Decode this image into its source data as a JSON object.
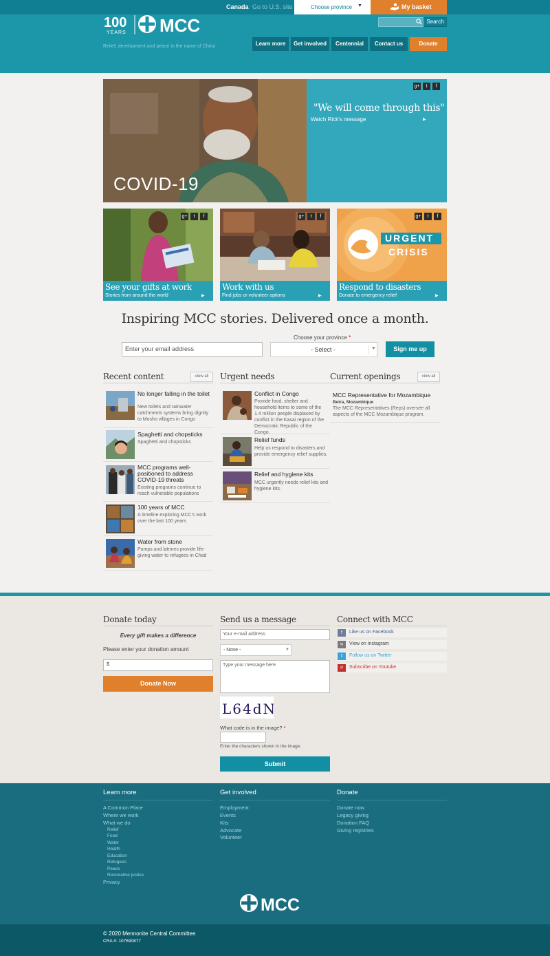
{
  "topbar": {
    "country": "Canada",
    "us_link": "Go to U.S. site",
    "province": "Choose province",
    "basket": "My basket"
  },
  "header": {
    "logo_years": "100",
    "logo_years_sub": "YEARS",
    "logo_name": "MCC",
    "tagline": "Relief, development and peace in the name of Christ",
    "search_button": "Search",
    "nav": [
      "Learn more",
      "Get involved",
      "Centennial",
      "Contact us",
      "Donate"
    ]
  },
  "hero": {
    "quote": "\"We will come through this\"",
    "link": "Watch Rick's message",
    "overlay": "COVID-19"
  },
  "social": [
    "g+",
    "t",
    "f"
  ],
  "tiles": [
    {
      "title": "See your gifts at work",
      "sub": "Stories from around the world"
    },
    {
      "title": "Work with us",
      "sub": "Find jobs or volunteer options"
    },
    {
      "title": "Respond to disasters",
      "sub": "Donate to emergency relief",
      "badge_top": "URGENT",
      "badge_bottom": "CRISIS"
    }
  ],
  "newsletter": {
    "title": "Inspiring MCC stories. Delivered once a month.",
    "email_placeholder": "Enter your email address",
    "province_label": "Choose your province",
    "required": "*",
    "select_value": "- Select -",
    "button": "Sign me up"
  },
  "recent": {
    "heading": "Recent content",
    "view_all": "view all",
    "items": [
      {
        "title": "No longer falling in the toilet",
        "desc": "New toilets and rainwater catchments systems bring dignity to Mosho villages in Congo"
      },
      {
        "title": "Spaghetti and chopsticks",
        "desc": "Spaghetti and chopsticks"
      },
      {
        "title": "MCC programs well-positioned to address COVID-19 threats",
        "desc": "Existing programs continue to reach vulnerable populations"
      },
      {
        "title": "100 years of MCC",
        "desc": "A timeline exploring MCC's work over the last 100 years"
      },
      {
        "title": "Water from stone",
        "desc": "Pumps and latrines provide life-giving water to refugees in Chad"
      }
    ]
  },
  "urgent": {
    "heading": "Urgent needs",
    "items": [
      {
        "title": "Conflict in Congo",
        "desc": "Provide food, shelter and household items to some of the 1.4 million people displaced by conflict in the Kasai region of the Democratic Republic of the Congo."
      },
      {
        "title": "Relief funds",
        "desc": "Help us respond to disasters and provide emergency relief supplies."
      },
      {
        "title": "Relief and hygiene kits",
        "desc": "MCC urgently needs relief kits and hygiene kits."
      }
    ]
  },
  "openings": {
    "heading": "Current openings",
    "view_all": "view all",
    "title": "MCC Representative for Mozambique",
    "location": "Beira, Mozambique",
    "desc": "The MCC Representatives (Reps) oversee all aspects of the MCC Mozambique program."
  },
  "donate_form": {
    "heading": "Donate today",
    "tagline": "Every gift makes a difference",
    "label": "Please enter your donation amount",
    "currency": "$",
    "button": "Donate Now"
  },
  "message_form": {
    "heading": "Send us a message",
    "email_placeholder": "Your e-mail address",
    "select_value": "- None -",
    "message_placeholder": "Type your message here",
    "captcha_text": "L64dN",
    "captcha_label": "What code is in the image?",
    "required": "*",
    "captcha_hint": "Enter the characters shown in the image.",
    "button": "Submit"
  },
  "connect": {
    "heading": "Connect with MCC",
    "links": [
      {
        "label": "Like us on Facebook",
        "icon": "f",
        "color": "#3b5998"
      },
      {
        "label": "View on Instagram",
        "icon": "ig",
        "color": "#555555"
      },
      {
        "label": "Follow us on Twitter",
        "icon": "t",
        "color": "#3aa4d8"
      },
      {
        "label": "Subscribe on Youtube",
        "icon": "yt",
        "color": "#c4302b"
      }
    ]
  },
  "footer": {
    "learn": {
      "heading": "Learn more",
      "links": [
        "A Common Place",
        "Where we work",
        "What we do"
      ],
      "sub": [
        "Relief",
        "Food",
        "Water",
        "Health",
        "Education",
        "Refugees",
        "Peace",
        "Restorative justice"
      ],
      "last": "Privacy"
    },
    "involved": {
      "heading": "Get involved",
      "links": [
        "Employment",
        "Events",
        "Kits",
        "Advocate",
        "Volunteer"
      ]
    },
    "donate": {
      "heading": "Donate",
      "links": [
        "Donate now",
        "Legacy giving",
        "Donation FAQ",
        "Giving registries"
      ]
    },
    "logo": "MCC",
    "copyright": "© 2020 Mennonite Central Committee",
    "cra": "CRA #: 107690877"
  }
}
